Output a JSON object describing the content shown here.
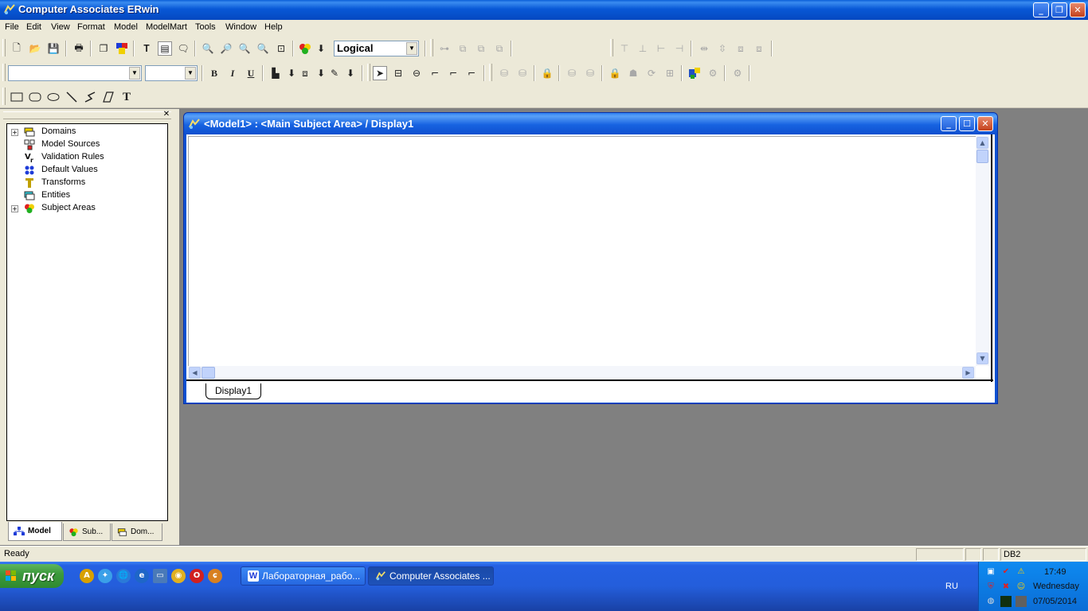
{
  "window": {
    "title": "Computer Associates ERwin",
    "minimize": "_",
    "restore": "❐",
    "close": "✕"
  },
  "menu": [
    "File",
    "Edit",
    "View",
    "Format",
    "Model",
    "ModelMart",
    "Tools",
    "Window",
    "Help"
  ],
  "toolbar": {
    "view_level": "Logical",
    "font_name": "",
    "font_size": "",
    "bold": "B",
    "italic": "I",
    "underline": "U",
    "text_tool": "T"
  },
  "model_explorer": {
    "close": "✕",
    "items": [
      {
        "label": "Domains",
        "icon": "domains-icon",
        "expandable": true
      },
      {
        "label": "Model Sources",
        "icon": "model-sources-icon",
        "expandable": false
      },
      {
        "label": "Validation Rules",
        "icon": "validation-rules-icon",
        "expandable": false
      },
      {
        "label": "Default Values",
        "icon": "default-values-icon",
        "expandable": false
      },
      {
        "label": "Transforms",
        "icon": "transforms-icon",
        "expandable": false
      },
      {
        "label": "Entities",
        "icon": "entities-icon",
        "expandable": false
      },
      {
        "label": "Subject Areas",
        "icon": "subject-areas-icon",
        "expandable": true
      }
    ],
    "tabs": [
      "Model",
      "Sub...",
      "Dom..."
    ]
  },
  "diagram_window": {
    "title": "<Model1> : <Main Subject Area> / Display1",
    "display_tab": "Display1"
  },
  "status": {
    "text": "Ready",
    "db": "DB2"
  },
  "taskbar": {
    "start": "пуск",
    "tasks": [
      {
        "label": "Лабораторная_рабо...",
        "active": false
      },
      {
        "label": "Computer Associates ...",
        "active": true
      }
    ],
    "language": "RU",
    "time": "17:49",
    "day": "Wednesday",
    "date": "07/05/2014"
  },
  "colors": {
    "title_blue": "#0858d6",
    "chrome": "#ece9d8",
    "workspace": "#808080",
    "start_green": "#3d9a3d"
  }
}
